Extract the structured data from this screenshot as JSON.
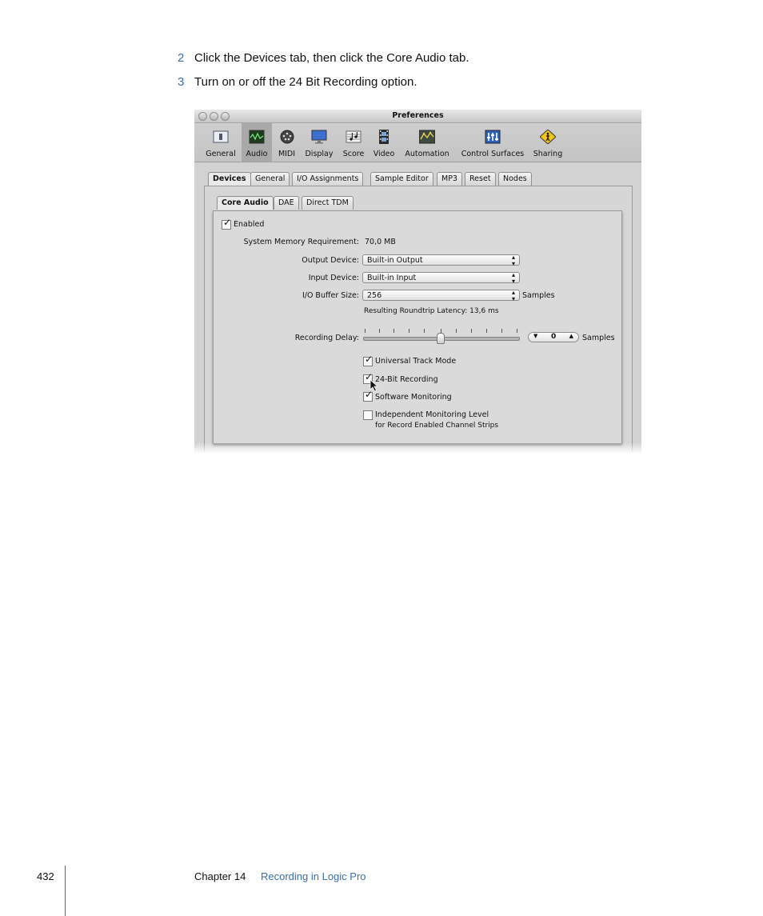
{
  "steps": [
    {
      "number": "2",
      "text": "Click the Devices tab, then click the Core Audio tab."
    },
    {
      "number": "3",
      "text": "Turn on or off the 24 Bit Recording option."
    }
  ],
  "window": {
    "title": "Preferences",
    "toolbar": [
      {
        "label": "General",
        "icon": "general-icon"
      },
      {
        "label": "Audio",
        "icon": "audio-icon",
        "selected": true
      },
      {
        "label": "MIDI",
        "icon": "midi-icon"
      },
      {
        "label": "Display",
        "icon": "display-icon"
      },
      {
        "label": "Score",
        "icon": "score-icon"
      },
      {
        "label": "Video",
        "icon": "video-icon"
      },
      {
        "label": "Automation",
        "icon": "automation-icon"
      },
      {
        "label": "Control Surfaces",
        "icon": "control-surfaces-icon"
      },
      {
        "label": "Sharing",
        "icon": "sharing-icon"
      }
    ],
    "tabs": [
      "Devices",
      "General",
      "I/O Assignments",
      "Sample Editor",
      "MP3",
      "Reset",
      "Nodes"
    ],
    "subtabs": [
      "Core Audio",
      "DAE",
      "Direct TDM"
    ],
    "enabled_label": "Enabled",
    "memory_label": "System Memory Requirement:",
    "memory_value": "70,0 MB",
    "output_label": "Output Device:",
    "output_value": "Built-in Output",
    "input_label": "Input Device:",
    "input_value": "Built-in Input",
    "buffer_label": "I/O Buffer Size:",
    "buffer_value": "256",
    "buffer_unit": "Samples",
    "latency_text": "Resulting Roundtrip Latency: 13,6 ms",
    "delay_label": "Recording Delay:",
    "delay_value": "0",
    "delay_unit": "Samples",
    "options": [
      {
        "label": "Universal Track Mode",
        "checked": true
      },
      {
        "label": "24-Bit Recording",
        "checked": true
      },
      {
        "label": "Software Monitoring",
        "checked": true
      },
      {
        "label": "Independent Monitoring Level",
        "checked": false
      }
    ],
    "monitoring_sub": "for Record Enabled Channel Strips"
  },
  "footer": {
    "page_number": "432",
    "chapter": "Chapter 14",
    "chapter_title": "Recording in Logic Pro"
  },
  "colors": {
    "accent": "#3a6fb0"
  }
}
